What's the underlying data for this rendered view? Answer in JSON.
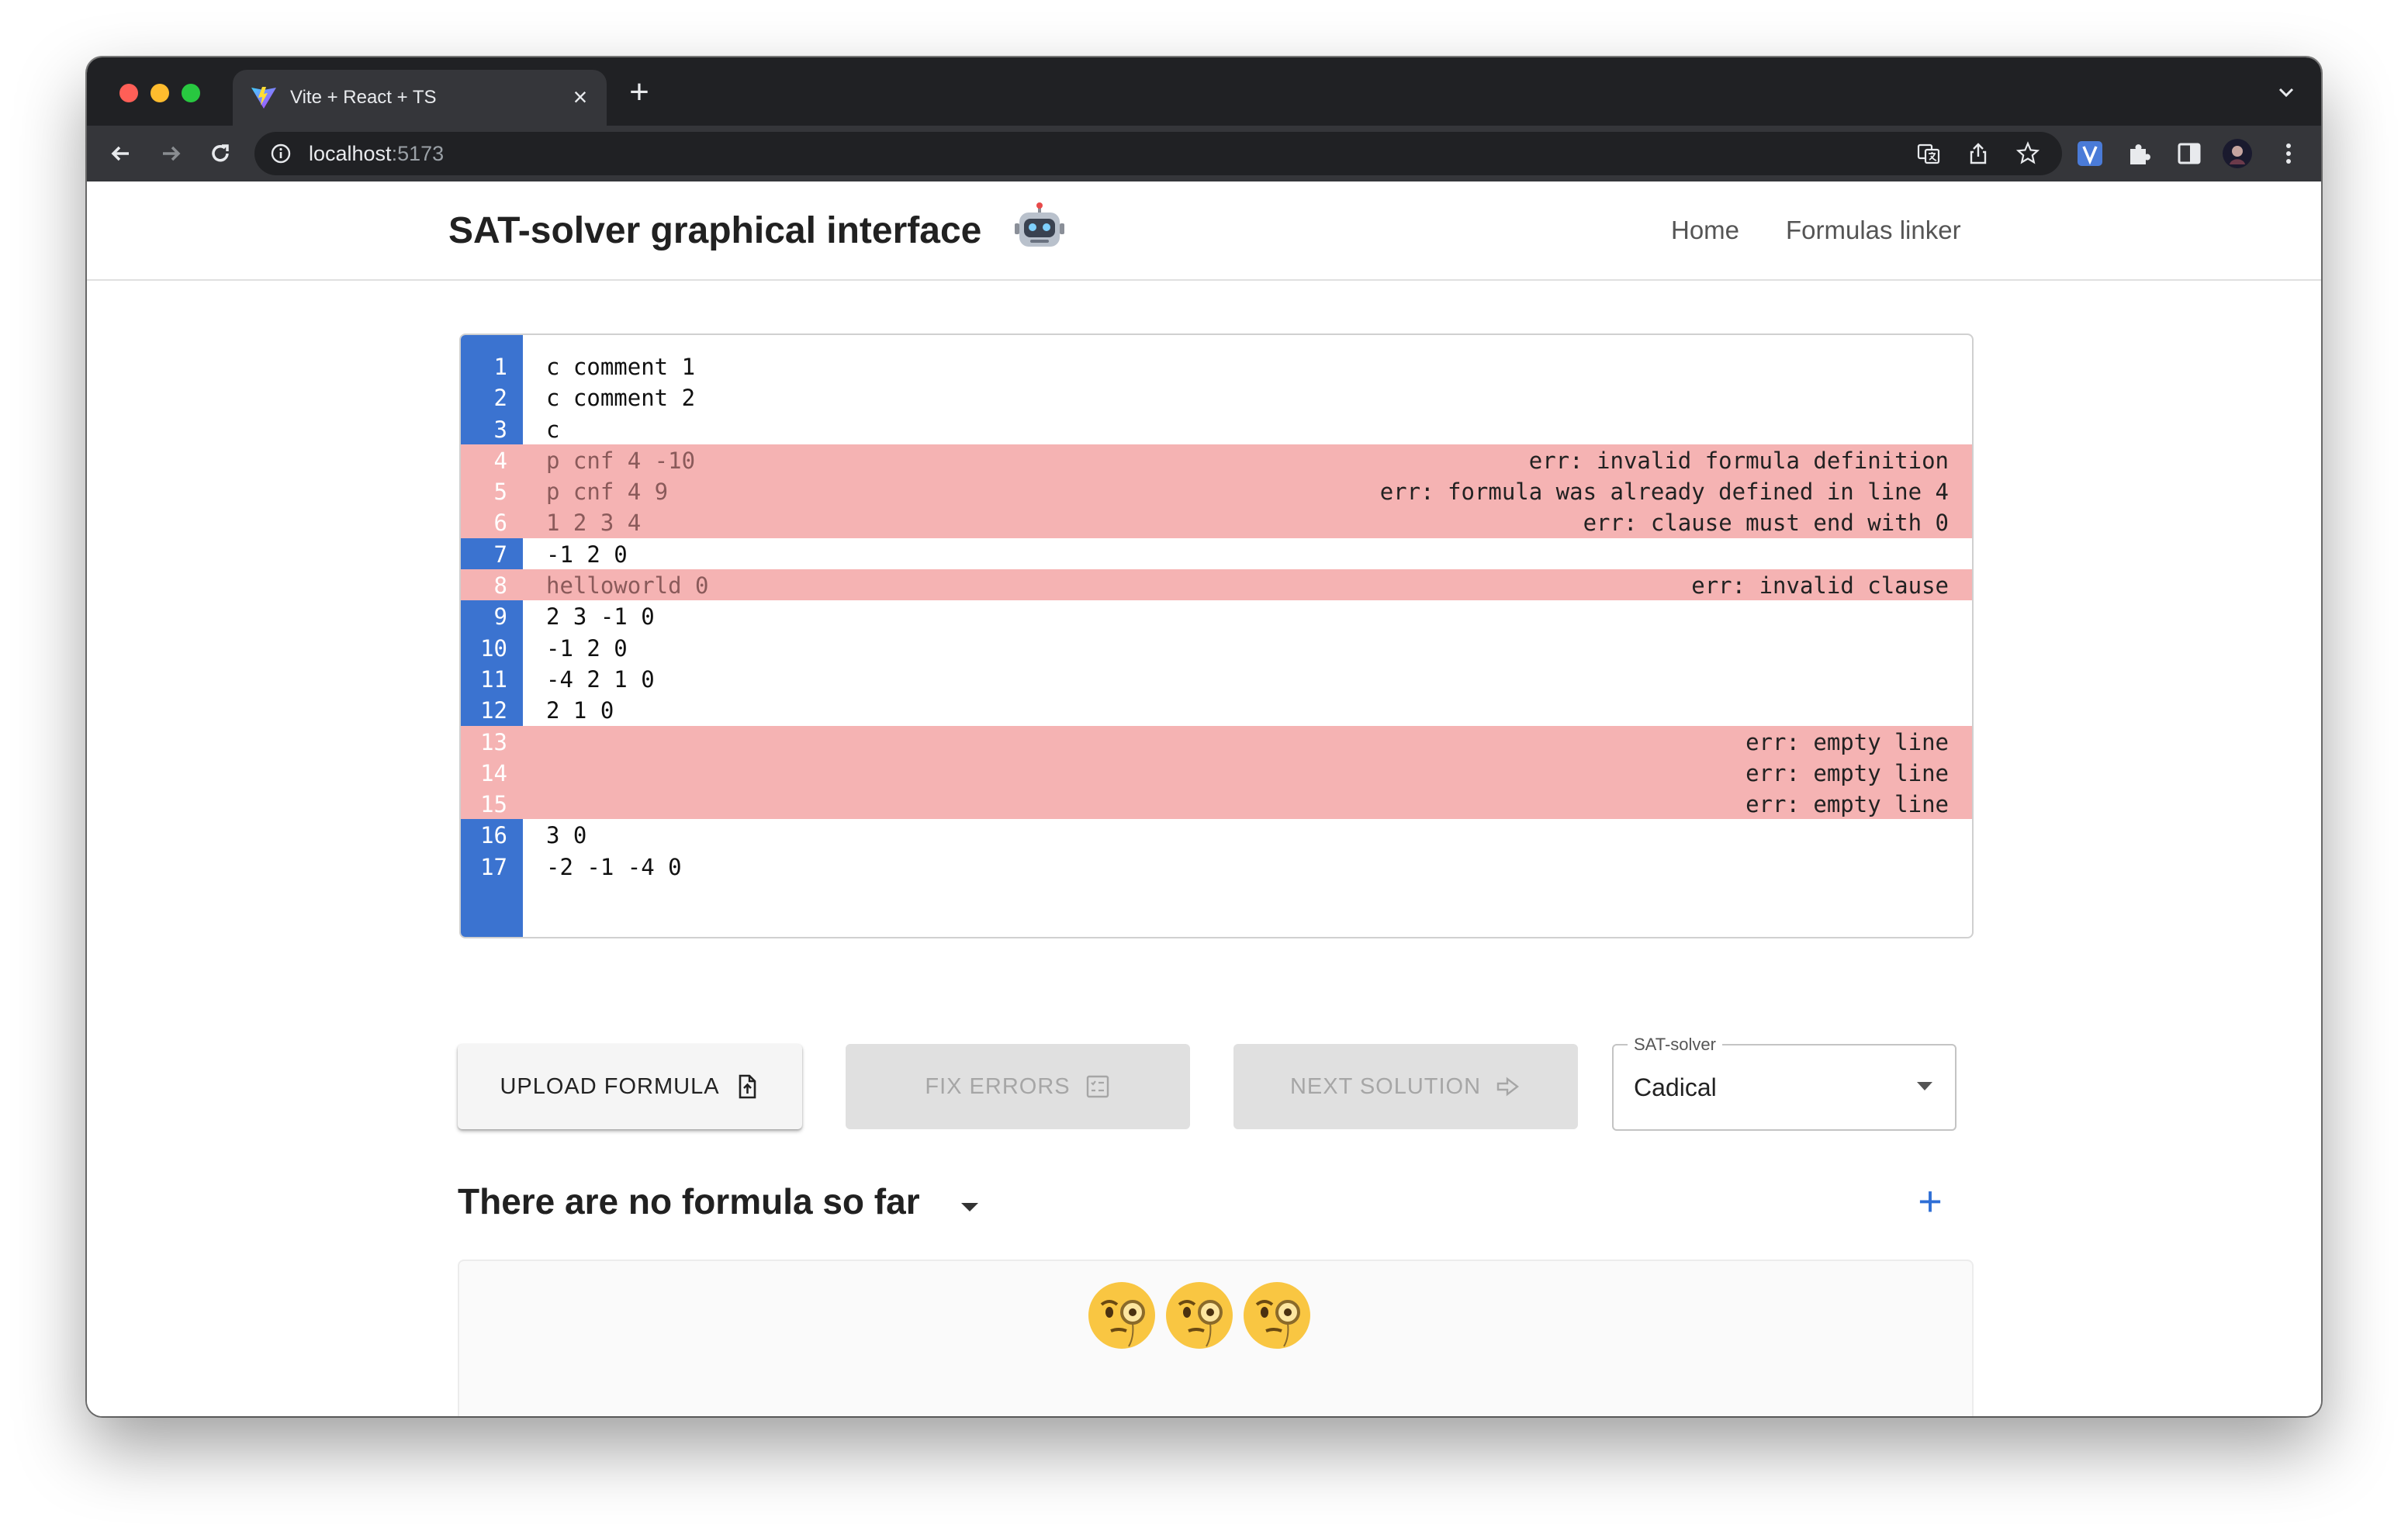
{
  "browser": {
    "tab_title": "Vite + React + TS",
    "url_host": "localhost",
    "url_port": ":5173"
  },
  "app": {
    "title": "SAT-solver graphical interface",
    "nav": [
      "Home",
      "Formulas linker"
    ]
  },
  "editor": {
    "lines": [
      {
        "no": "1",
        "text": "c comment 1",
        "error": ""
      },
      {
        "no": "2",
        "text": "c comment 2",
        "error": ""
      },
      {
        "no": "3",
        "text": "c",
        "error": ""
      },
      {
        "no": "4",
        "text": "p cnf 4 -10",
        "error": "err: invalid formula definition"
      },
      {
        "no": "5",
        "text": "p cnf 4 9",
        "error": "err: formula was already defined in line 4"
      },
      {
        "no": "6",
        "text": "1 2 3 4",
        "error": "err: clause must end with 0"
      },
      {
        "no": "7",
        "text": "-1 2 0",
        "error": ""
      },
      {
        "no": "8",
        "text": "helloworld 0",
        "error": "err: invalid clause"
      },
      {
        "no": "9",
        "text": "2 3 -1 0",
        "error": ""
      },
      {
        "no": "10",
        "text": "-1 2 0",
        "error": ""
      },
      {
        "no": "11",
        "text": "-4 2 1 0",
        "error": ""
      },
      {
        "no": "12",
        "text": "2 1 0",
        "error": ""
      },
      {
        "no": "13",
        "text": "",
        "error": "err: empty line"
      },
      {
        "no": "14",
        "text": "",
        "error": "err: empty line"
      },
      {
        "no": "15",
        "text": "",
        "error": "err: empty line"
      },
      {
        "no": "16",
        "text": "3 0",
        "error": ""
      },
      {
        "no": "17",
        "text": "-2 -1 -4 0",
        "error": ""
      }
    ]
  },
  "actions": {
    "upload_label": "UPLOAD FORMULA",
    "fix_label": "FIX ERRORS",
    "next_label": "NEXT SOLUTION"
  },
  "solver_select": {
    "label": "SAT-solver",
    "value": "Cadical"
  },
  "formulas": {
    "heading": "There are no formula so far"
  },
  "colors": {
    "gutter": "#3b73d0",
    "error_row": "#f5b3b3",
    "accent": "#2f6fd6"
  }
}
